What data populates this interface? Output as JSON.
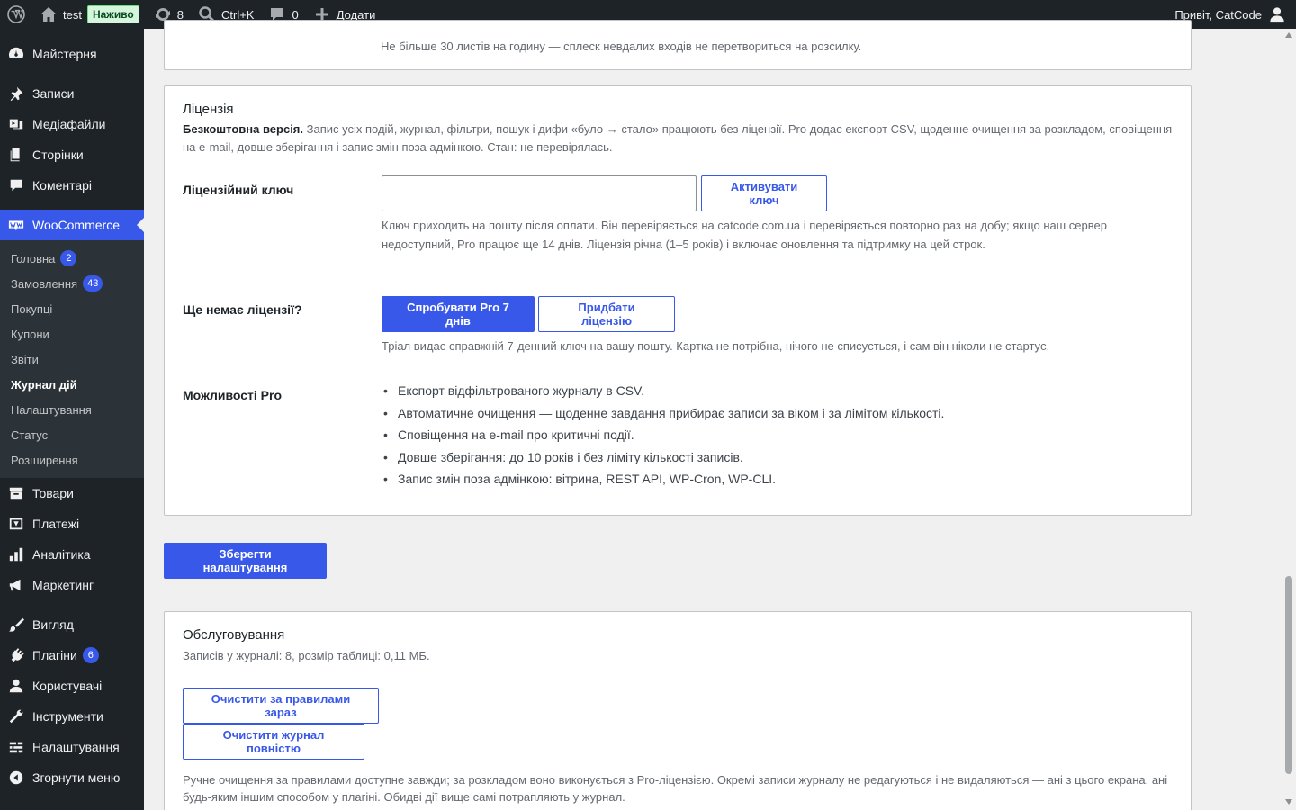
{
  "adminbar": {
    "site_name": "test",
    "live_badge": "Наживо",
    "updates_count": "8",
    "search_shortcut": "Ctrl+K",
    "comments_count": "0",
    "add_new_label": "Додати",
    "greeting": "Привіт, CatCode"
  },
  "sidebar": {
    "dashboard": "Майстерня",
    "posts": "Записи",
    "media": "Медіафайли",
    "pages": "Сторінки",
    "comments": "Коментарі",
    "woocommerce": "WooCommerce",
    "woo_sub": [
      {
        "label": "Головна",
        "badge": "2"
      },
      {
        "label": "Замовлення",
        "badge": "43"
      },
      {
        "label": "Покупці"
      },
      {
        "label": "Купони"
      },
      {
        "label": "Звіти"
      },
      {
        "label": "Журнал дій"
      },
      {
        "label": "Налаштування"
      },
      {
        "label": "Статус"
      },
      {
        "label": "Розширення"
      }
    ],
    "products": "Товари",
    "payments": "Платежі",
    "analytics": "Аналітика",
    "marketing": "Маркетинг",
    "appearance": "Вигляд",
    "plugins": "Плагіни",
    "plugins_badge": "6",
    "users": "Користувачі",
    "tools": "Інструменти",
    "settings": "Налаштування",
    "collapse": "Згорнути меню"
  },
  "email_card": {
    "help": "Не більше 30 листів на годину — сплеск невдалих входів не перетвориться на розсилку."
  },
  "license": {
    "title": "Ліцензія",
    "free_bold": "Безкоштовна версія.",
    "free_text": "Запис усіх подій, журнал, фільтри, пошук і дифи «було → стало» працюють без ліцензії. Pro додає експорт CSV, щоденне очищення за розкладом, сповіщення на e-mail, довше зберігання і запис змін поза адмінкою. Стан: не перевірялась.",
    "key_label": "Ліцензійний ключ",
    "key_value": "",
    "activate_button": "Активувати ключ",
    "key_help": "Ключ приходить на пошту після оплати. Він перевіряється на catcode.com.ua і перевіряється повторно раз на добу; якщо наш сервер недоступний, Pro працює ще 14 днів. Ліцензія річна (1–5 років) і включає оновлення та підтримку на цей строк.",
    "no_license_label": "Ще немає ліцензії?",
    "trial_button": "Спробувати Pro 7 днів",
    "buy_button": "Придбати ліцензію",
    "trial_help": "Тріал видає справжній 7-денний ключ на вашу пошту. Картка не потрібна, нічого не списується, і сам він ніколи не стартує.",
    "pro_features_label": "Можливості Pro",
    "pro_features": [
      "Експорт відфільтрованого журналу в CSV.",
      "Автоматичне очищення — щоденне завдання прибирає записи за віком і за лімітом кількості.",
      "Сповіщення на e-mail про критичні події.",
      "Довше зберігання: до 10 років і без ліміту кількості записів.",
      "Запис змін поза адмінкою: вітрина, REST API, WP-Cron, WP-CLI."
    ]
  },
  "save_button": "Зберегти налаштування",
  "maintenance": {
    "title": "Обслуговування",
    "stats": "Записів у журналі: 8, розмір таблиці: 0,11 МБ.",
    "cleanup_rules_button": "Очистити за правилами зараз",
    "cleanup_all_button": "Очистити журнал повністю",
    "help": "Ручне очищення за правилами доступне завжди; за розкладом воно виконується з Pro-ліцензією. Окремі записи журналу не редагуються і не видаляються — ані з цього екрана, ані будь-яким іншим способом у плагіні. Обидві дії вище самі потрапляють у журнал."
  },
  "colors": {
    "accent": "#3858e9",
    "adminbar_bg": "#1d2327",
    "submenu_bg": "#2c3338"
  }
}
